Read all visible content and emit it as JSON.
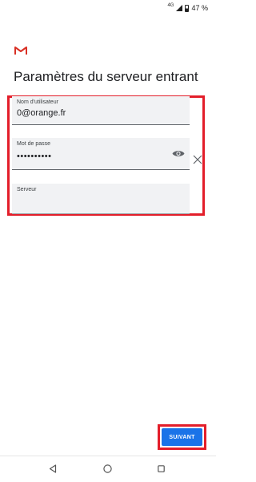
{
  "status_bar": {
    "network": "4G",
    "battery": "47 %"
  },
  "colors": {
    "accent": "#1a73e8",
    "highlight": "#e31e2a",
    "gmail_red": "#d93025"
  },
  "header": {
    "logo_icon": "gmail-logo",
    "title": "Paramètres du serveur entrant"
  },
  "form": {
    "username": {
      "label": "Nom d'utilisateur",
      "value": "0@orange.fr"
    },
    "password": {
      "label": "Mot de passe",
      "value": "••••••••••",
      "toggle_icon": "eye-icon"
    },
    "server": {
      "label": "Serveur",
      "value": ""
    },
    "clear_icon": "close-icon"
  },
  "actions": {
    "next_label": "SUIVANT"
  },
  "nav": {
    "back_icon": "back-triangle-icon",
    "home_icon": "home-circle-icon",
    "recent_icon": "recent-square-icon"
  }
}
